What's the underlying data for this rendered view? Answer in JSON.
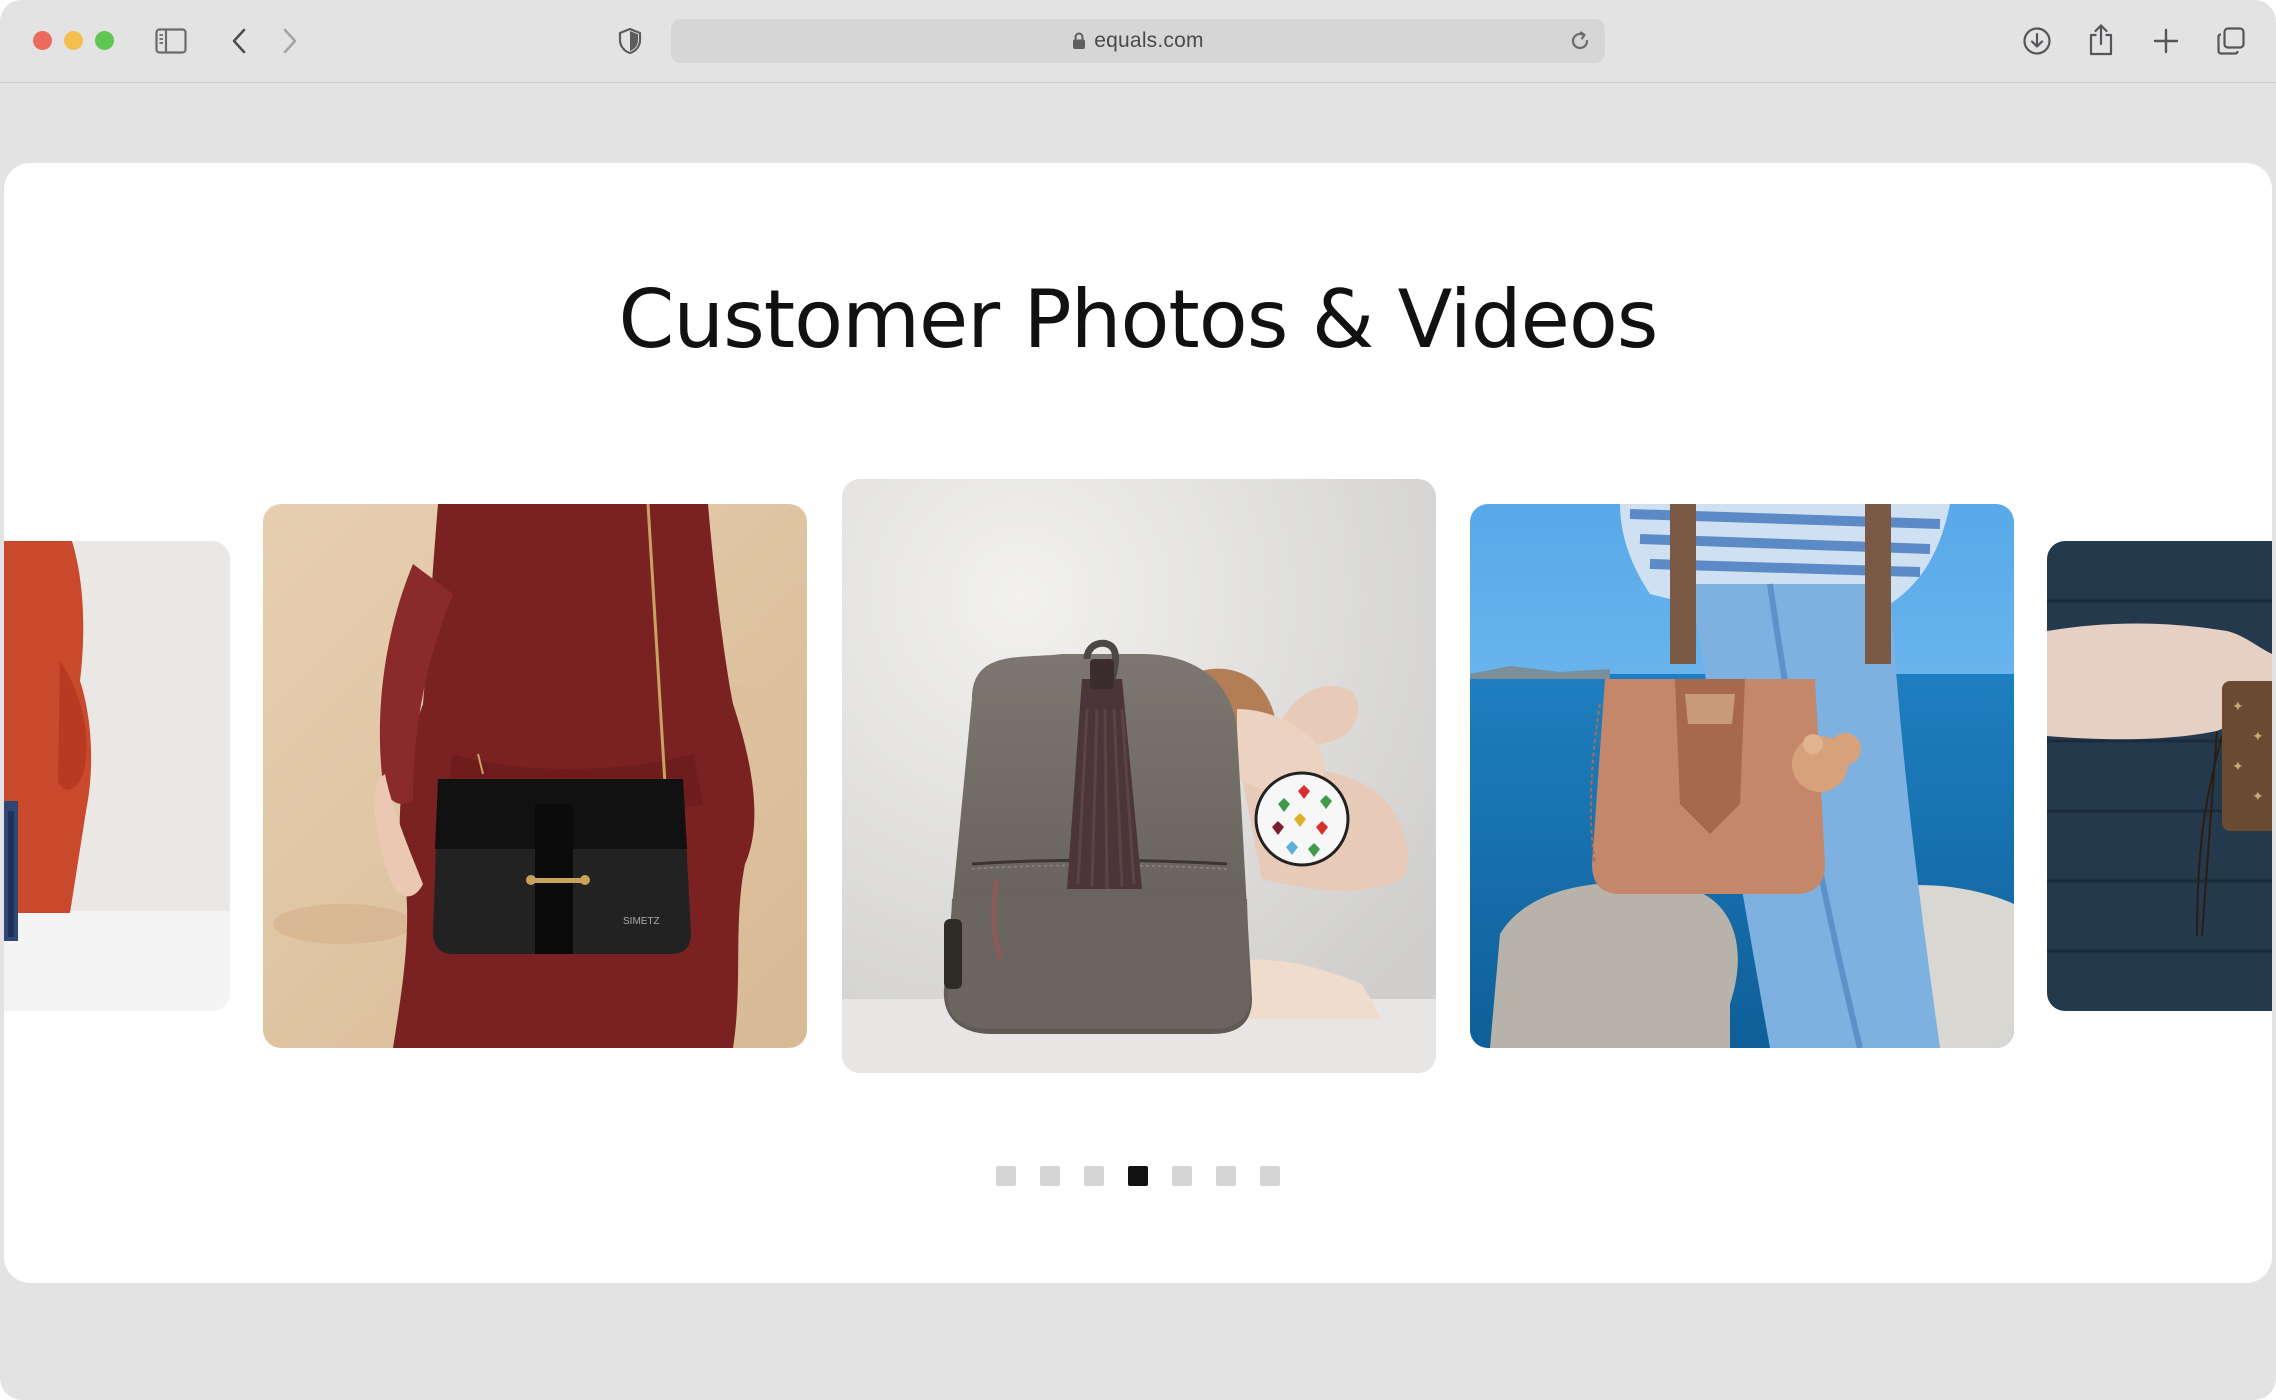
{
  "browser": {
    "url": "equals.com",
    "toolbar_icons": [
      "sidebar-icon",
      "back-icon",
      "forward-icon",
      "shield-icon",
      "download-icon",
      "share-icon",
      "new-tab-icon",
      "tabs-overview-icon"
    ]
  },
  "section": {
    "title": "Customer Photos & Videos"
  },
  "carousel": {
    "slides": [
      {
        "name": "red-dress-partial-photo"
      },
      {
        "name": "black-crossbody-bag-photo",
        "bag_label": "SIMETZ"
      },
      {
        "name": "grey-leather-backpack-photo"
      },
      {
        "name": "tan-leather-tote-photo"
      },
      {
        "name": "monogram-bag-partial-photo"
      }
    ],
    "dot_count": 7,
    "active_index": 3
  },
  "colors": {
    "active_dot": "#111111",
    "inactive_dot": "#d4d4d4",
    "chrome": "#e3e3e4"
  }
}
